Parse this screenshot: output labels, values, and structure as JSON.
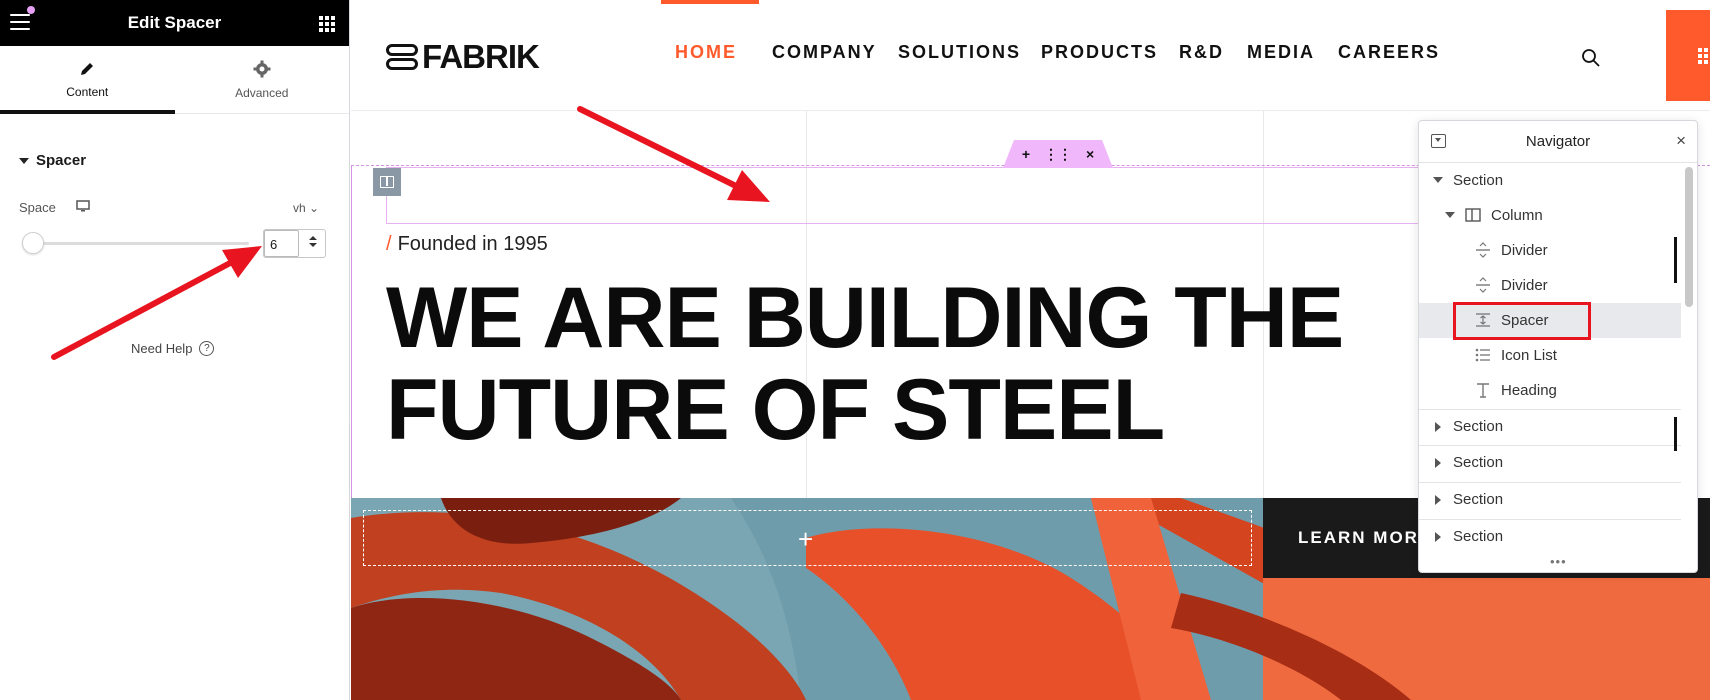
{
  "panel": {
    "title": "Edit Spacer",
    "tabs": [
      {
        "label": "Content",
        "icon": "pencil-icon"
      },
      {
        "label": "Advanced",
        "icon": "gear-icon"
      }
    ],
    "section": "Spacer",
    "space": {
      "label": "Space",
      "unit": "vh",
      "value": "6",
      "slider_fraction": 0.06
    },
    "help": "Need Help"
  },
  "site": {
    "logo": "FABRIK",
    "nav": [
      "HOME",
      "COMPANY",
      "SOLUTIONS",
      "PRODUCTS",
      "R&D",
      "MEDIA",
      "CAREERS"
    ],
    "active_nav": "HOME",
    "founded": "Founded in 1995",
    "hero_line1": "WE ARE BUILDING THE",
    "hero_line2": "FUTURE OF STEEL",
    "cta": "LEARN MORE",
    "handle_icons": [
      "+",
      "⋮⋮",
      "×"
    ]
  },
  "navigator": {
    "title": "Navigator",
    "items": [
      {
        "label": "Section",
        "level": 0,
        "expanded": true
      },
      {
        "label": "Column",
        "level": 1,
        "expanded": true
      },
      {
        "label": "Divider",
        "level": 2
      },
      {
        "label": "Divider",
        "level": 2
      },
      {
        "label": "Spacer",
        "level": 2,
        "selected": true
      },
      {
        "label": "Icon List",
        "level": 2
      },
      {
        "label": "Heading",
        "level": 2
      },
      {
        "label": "Section",
        "level": 0,
        "expanded": false
      },
      {
        "label": "Section",
        "level": 0,
        "expanded": false
      },
      {
        "label": "Section",
        "level": 0,
        "expanded": false
      },
      {
        "label": "Section",
        "level": 0,
        "expanded": false
      }
    ]
  },
  "colors": {
    "accent": "#ff5a2c",
    "editor_pink": "#f0b7fb",
    "annotation_red": "#e8141f"
  }
}
